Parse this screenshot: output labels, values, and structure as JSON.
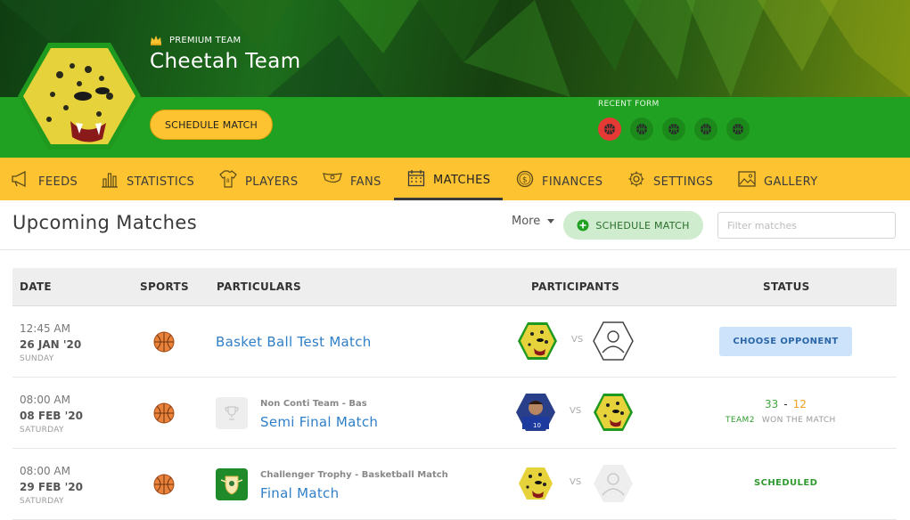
{
  "team": {
    "badge": "PREMIUM TEAM",
    "name": "Cheetah Team",
    "schedule_label": "SCHEDULE MATCH",
    "recent_form_label": "RECENT FORM",
    "recent_form": [
      "loss",
      "win",
      "win",
      "win",
      "win"
    ]
  },
  "tabs": [
    {
      "label": "FEEDS",
      "icon": "megaphone-icon"
    },
    {
      "label": "STATISTICS",
      "icon": "bar-chart-icon"
    },
    {
      "label": "PLAYERS",
      "icon": "jersey-icon"
    },
    {
      "label": "FANS",
      "icon": "fans-icon"
    },
    {
      "label": "MATCHES",
      "icon": "calendar-icon",
      "active": true
    },
    {
      "label": "FINANCES",
      "icon": "dollar-coin-icon"
    },
    {
      "label": "SETTINGS",
      "icon": "gear-icon"
    },
    {
      "label": "GALLERY",
      "icon": "image-icon"
    }
  ],
  "section": {
    "title": "Upcoming Matches",
    "more_label": "More",
    "schedule_label": "SCHEDULE MATCH",
    "filter_placeholder": "Filter matches"
  },
  "table": {
    "headers": [
      "DATE",
      "SPORTS",
      "PARTICULARS",
      "PARTICIPANTS",
      "STATUS"
    ],
    "vs": "VS",
    "rows": [
      {
        "time": "12:45 AM",
        "date": "26 JAN '20",
        "day": "SUNDAY",
        "sport": "basketball",
        "subtitle": "",
        "title": "Basket Ball Test Match",
        "status_type": "button",
        "status_label": "CHOOSE OPPONENT"
      },
      {
        "time": "08:00 AM",
        "date": "08 FEB '20",
        "day": "SATURDAY",
        "sport": "basketball",
        "subtitle": "Non Conti Team - Bas",
        "title": "Semi Final Match",
        "status_type": "result",
        "score_home": "33",
        "score_sep": "-",
        "score_away": "12",
        "winner": "TEAM2",
        "result_text": "WON THE MATCH"
      },
      {
        "time": "08:00 AM",
        "date": "29 FEB '20",
        "day": "SATURDAY",
        "sport": "basketball",
        "subtitle": "Challenger Trophy - Basketball Match",
        "title": "Final Match",
        "status_type": "text",
        "status_label": "SCHEDULED"
      }
    ]
  },
  "colors": {
    "accent_yellow": "#fdc331",
    "green": "#21a121",
    "link_blue": "#2f7fc8"
  }
}
